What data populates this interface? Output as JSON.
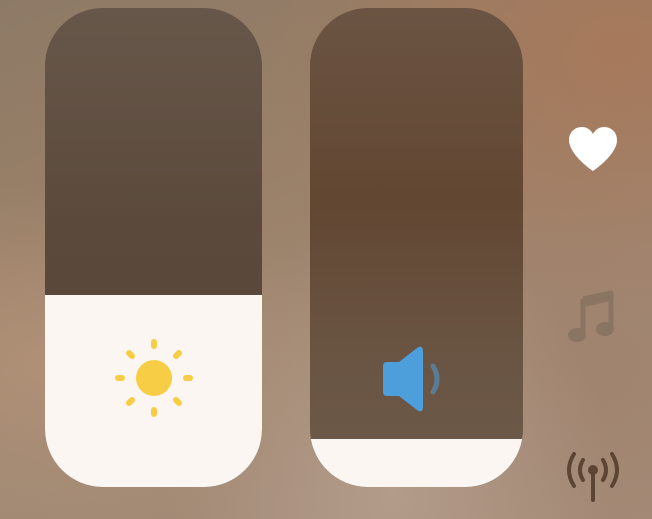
{
  "control_center": {
    "brightness_slider": {
      "level": 0.4,
      "icon": "sun-icon",
      "icon_color": "#f7cd45"
    },
    "volume_slider": {
      "level": 0.1,
      "icon": "speaker-icon",
      "icon_color": "#4c9fdb"
    },
    "side_controls": [
      {
        "icon": "heart-icon",
        "color": "#ffffff"
      },
      {
        "icon": "music-note-icon",
        "color": "#8a7462"
      },
      {
        "icon": "antenna-icon",
        "color": "#5c4535"
      }
    ]
  }
}
